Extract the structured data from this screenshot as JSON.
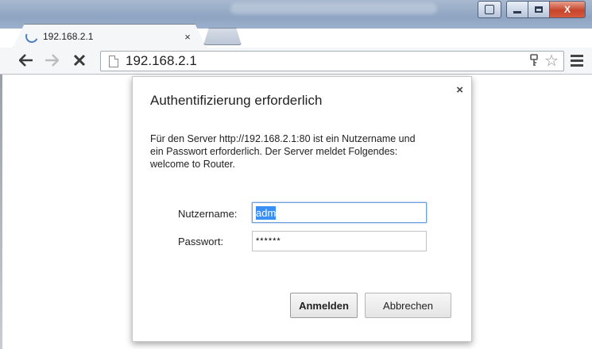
{
  "browser": {
    "tab": {
      "title": "192.168.2.1",
      "close_glyph": "×"
    },
    "url": "192.168.2.1",
    "icons": {
      "back": "arrow-left-icon",
      "forward": "arrow-right-icon",
      "stop": "stop-icon",
      "page": "page-icon",
      "key": "key-icon",
      "bookmark": "star-icon",
      "menu": "hamburger-menu-icon"
    }
  },
  "dialog": {
    "title": "Authentifizierung erforderlich",
    "close_glyph": "×",
    "message_lines": [
      "Für den Server http://192.168.2.1:80 ist ein Nutzername und",
      "ein Passwort erforderlich. Der Server meldet Folgendes:",
      "welcome to Router."
    ],
    "username_label": "Nutzername:",
    "username_value": "adm",
    "password_label": "Passwort:",
    "password_value": "******",
    "login_button": "Anmelden",
    "cancel_button": "Abbrechen"
  },
  "colors": {
    "selection": "#3a8ff6",
    "focus_border": "#6d9edc",
    "close_button": "#c6452b"
  }
}
